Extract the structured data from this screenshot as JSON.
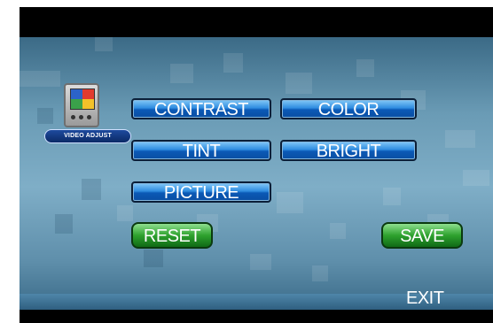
{
  "icon": {
    "name": "video-adjust-icon",
    "label": "VIDEO ADJUST"
  },
  "buttons": {
    "contrast": "CONTRAST",
    "color": "COLOR",
    "tint": "TINT",
    "bright": "BRIGHT",
    "picture": "PICTURE",
    "reset": "RESET",
    "save": "SAVE",
    "exit": "EXIT"
  },
  "colors": {
    "panel_top": "#3b6a86",
    "panel_mid": "#7faec7",
    "blue_button": "#2f8ce0",
    "green_button": "#2ea22e",
    "frame": "#000000"
  }
}
